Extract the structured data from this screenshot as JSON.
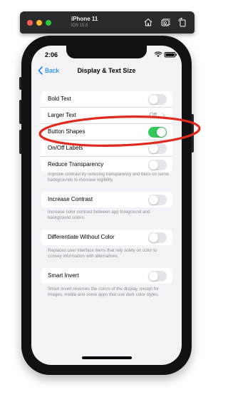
{
  "simulator": {
    "device": "iPhone 11",
    "os": "iOS 15.5",
    "toolbar_icons": [
      "home-icon",
      "screenshot-icon",
      "rotate-icon"
    ]
  },
  "status_bar": {
    "time": "2:06"
  },
  "nav": {
    "back_label": "Back",
    "title": "Display & Text Size"
  },
  "groups": [
    {
      "rows": [
        {
          "label": "Bold Text",
          "toggle": false
        },
        {
          "label": "Larger Text",
          "value": "Off",
          "chevron": true
        },
        {
          "label": "Button Shapes",
          "toggle": true
        },
        {
          "label": "On/Off Labels",
          "toggle": false
        },
        {
          "label": "Reduce Transparency",
          "toggle": false
        }
      ],
      "footnote": "Improve contrast by reducing transparency and blurs on some backgrounds to increase legibility."
    },
    {
      "rows": [
        {
          "label": "Increase Contrast",
          "toggle": false
        }
      ],
      "footnote": "Increase color contrast between app foreground and background colors."
    },
    {
      "rows": [
        {
          "label": "Differentiate Without Color",
          "toggle": false
        }
      ],
      "footnote": "Replaces user interface items that rely solely on color to convey information with alternatives."
    },
    {
      "rows": [
        {
          "label": "Smart Invert",
          "toggle": false
        }
      ],
      "footnote": "Smart Invert reverses the colors of the display, except for images, media and some apps that use dark color styles."
    }
  ],
  "colors": {
    "accent": "#007aff",
    "toggle_on": "#34c759",
    "annotation": "#e0291f"
  }
}
